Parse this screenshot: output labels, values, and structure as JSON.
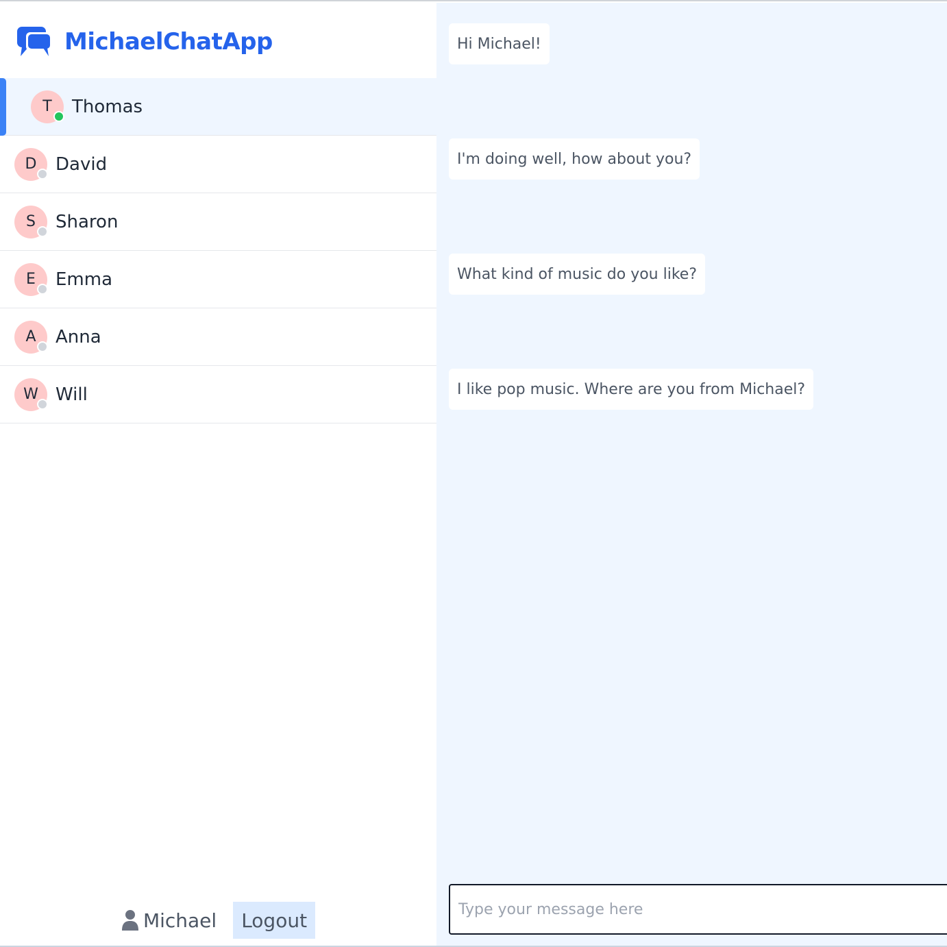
{
  "app": {
    "title": "MichaelChatApp",
    "accent_color": "#2563eb",
    "logo_icon": "chat-bubbles-icon"
  },
  "contacts": [
    {
      "initial": "T",
      "name": "Thomas",
      "status": "online",
      "active": true
    },
    {
      "initial": "D",
      "name": "David",
      "status": "offline",
      "active": false
    },
    {
      "initial": "S",
      "name": "Sharon",
      "status": "offline",
      "active": false
    },
    {
      "initial": "E",
      "name": "Emma",
      "status": "offline",
      "active": false
    },
    {
      "initial": "A",
      "name": "Anna",
      "status": "offline",
      "active": false
    },
    {
      "initial": "W",
      "name": "Will",
      "status": "offline",
      "active": false
    }
  ],
  "user": {
    "icon": "user-icon",
    "name": "Michael",
    "logout_label": "Logout"
  },
  "messages": [
    {
      "text": "Hi Michael!"
    },
    {
      "text": "I'm doing well, how about you?"
    },
    {
      "text": "What kind of music do you like?"
    },
    {
      "text": "I like pop music. Where are you from Michael?"
    }
  ],
  "composer": {
    "placeholder": "Type your message here",
    "value": ""
  }
}
